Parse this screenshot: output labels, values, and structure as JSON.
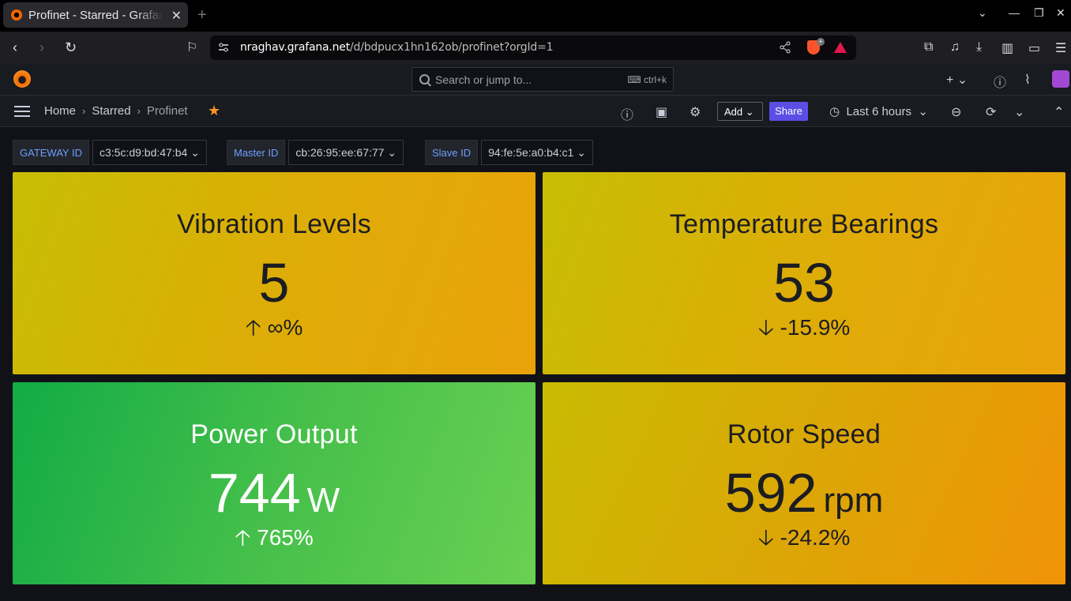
{
  "browser": {
    "tab_title": "Profinet - Starred - Grafana",
    "url_host": "nraghav.grafana.net",
    "url_path": "/d/bdpucx1hn162ob/profinet?orgId=1"
  },
  "grafana": {
    "search_placeholder": "Search or jump to...",
    "search_shortcut": "ctrl+k",
    "breadcrumbs": [
      "Home",
      "Starred",
      "Profinet"
    ],
    "add_label": "Add",
    "share_label": "Share",
    "time_range": "Last 6 hours"
  },
  "variables": [
    {
      "label": "GATEWAY ID",
      "value": "c3:5c:d9:bd:47:b4"
    },
    {
      "label": "Master ID",
      "value": "cb:26:95:ee:67:77"
    },
    {
      "label": "Slave ID",
      "value": "94:fe:5e:a0:b4:c1"
    }
  ],
  "panels": [
    {
      "title": "Vibration Levels",
      "value": "5",
      "unit": "",
      "change": "∞%",
      "direction": "up"
    },
    {
      "title": "Temperature Bearings",
      "value": "53",
      "unit": "",
      "change": "-15.9%",
      "direction": "down"
    },
    {
      "title": "Power Output",
      "value": "744",
      "unit": "W",
      "change": "765%",
      "direction": "up"
    },
    {
      "title": "Rotor Speed",
      "value": "592",
      "unit": "rpm",
      "change": "-24.2%",
      "direction": "down"
    }
  ],
  "colors": {
    "yellow_panel": "#dfac07",
    "green_panel": "#45bf4a",
    "share_button": "#5c4ee5",
    "star": "#f79520"
  }
}
